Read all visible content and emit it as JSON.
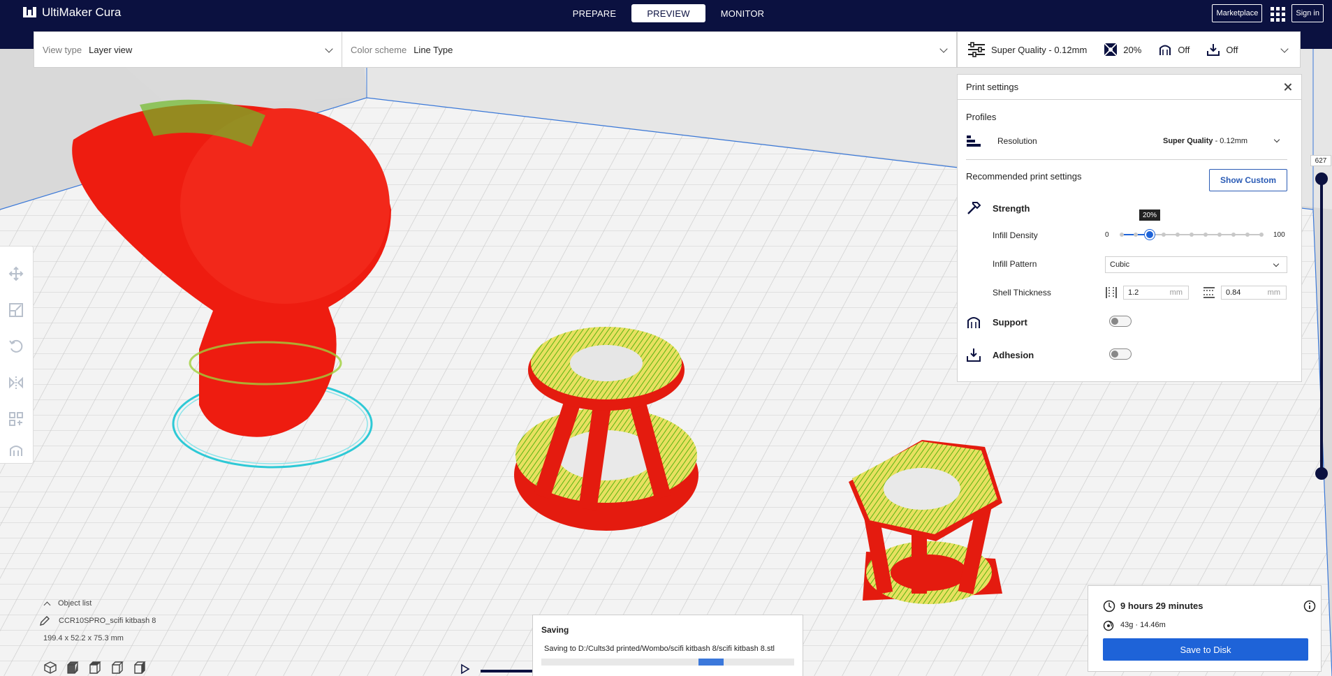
{
  "app": {
    "name": "UltiMaker Cura"
  },
  "stages": [
    {
      "label": "PREPARE",
      "active": false
    },
    {
      "label": "PREVIEW",
      "active": true
    },
    {
      "label": "MONITOR",
      "active": false
    }
  ],
  "header_right": {
    "marketplace": "Marketplace",
    "sign_in": "Sign in"
  },
  "view_bar": {
    "view_type_label": "View type",
    "view_type_value": "Layer view",
    "color_scheme_label": "Color scheme",
    "color_scheme_value": "Line Type"
  },
  "settings_header": {
    "profile": "Super Quality - 0.12mm",
    "infill": "20%",
    "support": "Off",
    "adhesion": "Off"
  },
  "print_settings": {
    "title": "Print settings",
    "profiles_label": "Profiles",
    "resolution_label": "Resolution",
    "resolution_value_bold": "Super Quality",
    "resolution_value_rest": " - 0.12mm",
    "recommended_label": "Recommended print settings",
    "show_custom": "Show Custom",
    "strength_label": "Strength",
    "infill_density_label": "Infill Density",
    "infill_density_value": "20%",
    "infill_min": "0",
    "infill_max": "100",
    "infill_fraction": 0.2,
    "infill_pattern_label": "Infill Pattern",
    "infill_pattern_value": "Cubic",
    "shell_thickness_label": "Shell Thickness",
    "wall_thickness": "1.2",
    "top_bottom_thickness": "0.84",
    "unit": "mm",
    "support_label": "Support",
    "adhesion_label": "Adhesion"
  },
  "layer_slider": {
    "max_layer": "627"
  },
  "object_list": {
    "toggle_label": "Object list",
    "object_name": "CCR10SPRO_scifi kitbash 8",
    "dimensions": "199.4 x 52.2 x 75.3 mm"
  },
  "saving": {
    "title": "Saving",
    "message": "Saving to D:/Cults3d printed/Wombo/scifi kitbash 8/scifi kitbash 8.stl"
  },
  "print_info": {
    "time": "9 hours 29 minutes",
    "material": "43g · 14.46m",
    "save_button": "Save to Disk"
  }
}
